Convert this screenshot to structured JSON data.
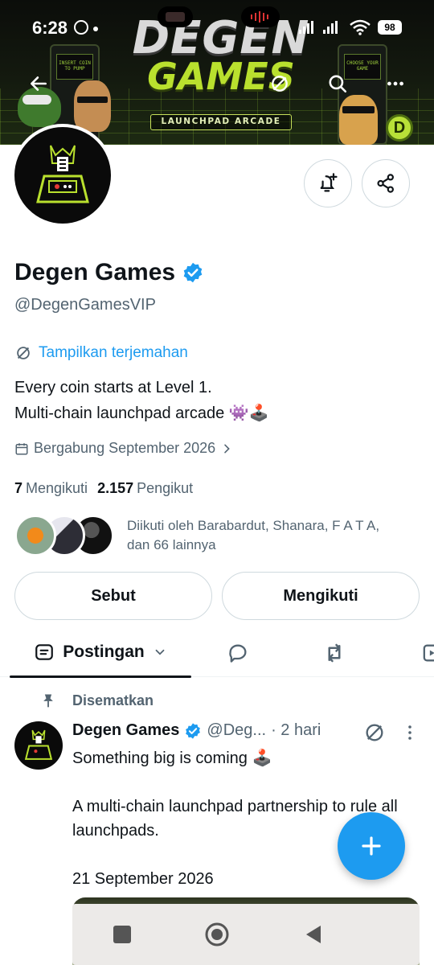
{
  "status_bar": {
    "time": "6:28",
    "battery": "98"
  },
  "banner": {
    "title_line1": "DEGEN",
    "title_line2": "GAMES",
    "tagline": "LAUNCHPAD ARCADE",
    "left_cabinet_text": "INSERT COIN TO PUMP",
    "right_cabinet_text": "CHOOSE YOUR GAME",
    "coin_letter": "D"
  },
  "header_actions": {
    "back_icon": "arrow-left-icon",
    "translate_icon": "translate-icon",
    "search_icon": "search-icon",
    "more_icon": "more-horizontal-icon"
  },
  "profile": {
    "name": "Degen Games",
    "handle": "@DegenGamesVIP",
    "verified": true,
    "translate_label": "Tampilkan terjemahan",
    "bio_line1": "Every coin starts at Level 1.",
    "bio_line2": "Multi-chain launchpad arcade 👾🕹️",
    "joined": "Bergabung September 2026",
    "following_count": "7",
    "following_label": "Mengikuti",
    "followers_count": "2.157",
    "followers_label": "Pengikut",
    "followed_by_line1": "Diikuti oleh Barabardut, Shanara, F A T A,",
    "followed_by_line2": "dan 66 lainnya"
  },
  "buttons": {
    "mention": "Sebut",
    "following": "Mengikuti"
  },
  "tabs": {
    "active": "Postingan"
  },
  "pinned_post": {
    "pinned_label": "Disematkan",
    "author_name": "Degen Games",
    "author_handle": "@Deg...",
    "time": "· 2 hari",
    "line1": "Something big is coming 🕹️",
    "line2": "A multi-chain launchpad partnership to rule all launchpads.",
    "line3": "21 September 2026"
  },
  "colors": {
    "accent": "#1d9bf0",
    "text": "#0f1419",
    "muted": "#536471",
    "border": "#cfd9de",
    "banner_green": "#b9e02e"
  }
}
